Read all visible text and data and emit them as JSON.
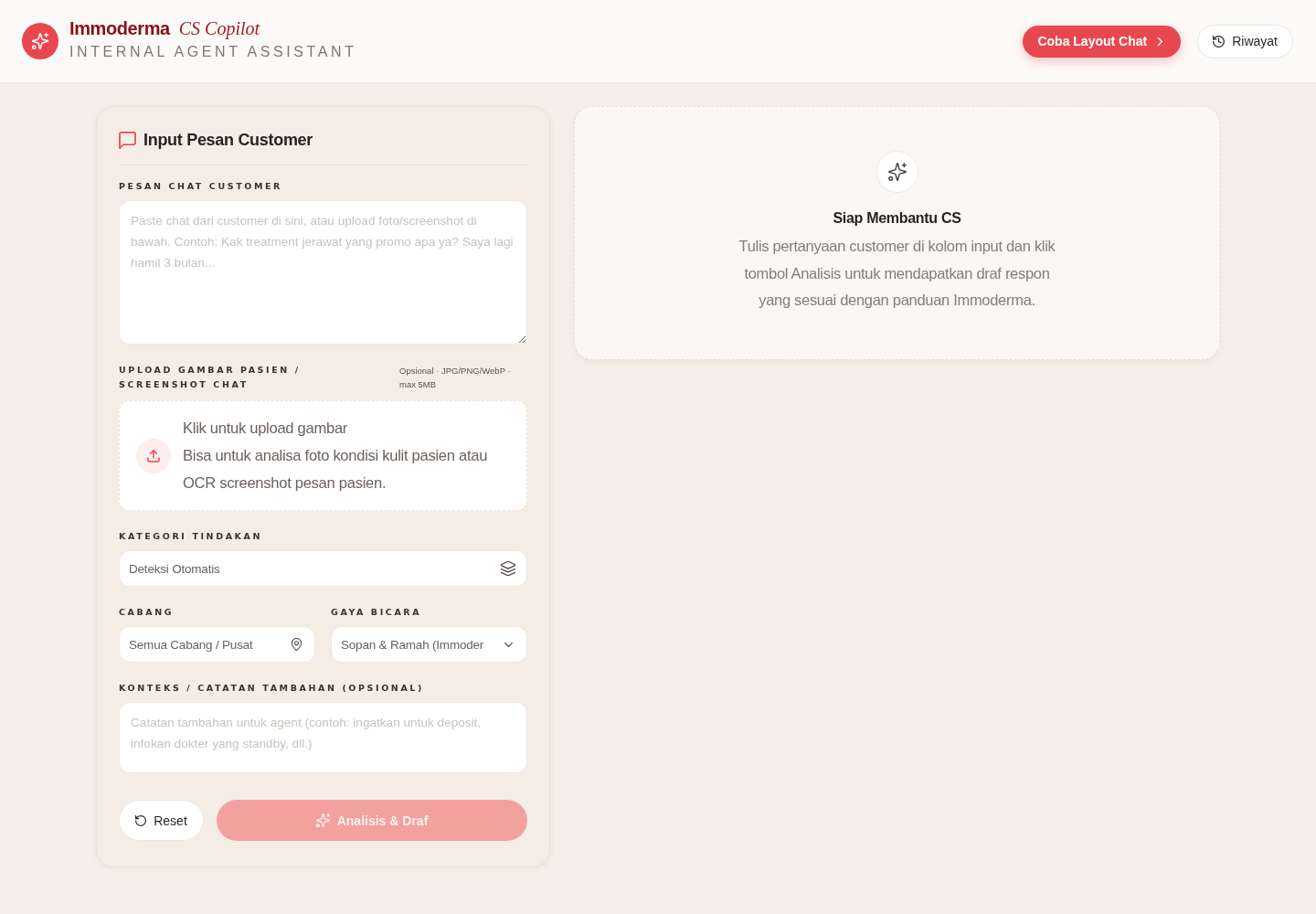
{
  "header": {
    "brand": "Immoderma",
    "product": "CS Copilot",
    "tagline": "INTERNAL AGENT ASSISTANT",
    "buttons": [
      {
        "label": "Coba Layout Chat",
        "kind": "primary"
      },
      {
        "label": "Riwayat",
        "kind": "history"
      }
    ]
  },
  "input_panel": {
    "title": "Input Pesan Customer",
    "message": {
      "label": "PESAN CHAT CUSTOMER",
      "placeholder": "Paste chat dari customer di sini, atau upload foto/screenshot di bawah. Contoh: Kak treatment jerawat yang promo apa ya? Saya lagi hamil 3 bulan..."
    },
    "upload": {
      "label": "UPLOAD GAMBAR PASIEN / SCREENSHOT CHAT",
      "hint": "Opsional · JPG/PNG/WebP · max 5MB",
      "title": "Klik untuk upload gambar",
      "description": "Bisa untuk analisa foto kondisi kulit pasien atau OCR screenshot pesan pasien."
    },
    "category": {
      "label": "KATEGORI TINDAKAN",
      "value": "Deteksi Otomatis"
    },
    "branch": {
      "label": "CABANG",
      "value": "Semua Cabang / Pusat"
    },
    "tone": {
      "label": "GAYA BICARA",
      "value": "Sopan & Ramah (Immoder"
    },
    "notes": {
      "label": "KONTEKS / CATATAN TAMBAHAN (OPSIONAL)",
      "placeholder": "Catatan tambahan untuk agent (contoh: ingatkan untuk deposit, infokan dokter yang standby, dll.)"
    },
    "actions": [
      {
        "label": "Reset",
        "kind": "reset",
        "disabled": false
      },
      {
        "label": "Analisis & Draf",
        "kind": "analyze",
        "disabled": true
      }
    ]
  },
  "result_panel": {
    "title": "Siap Membantu CS",
    "description": "Tulis pertanyaan customer di kolom input dan klik tombol Analisis untuk mendapatkan draf respon yang sesuai dengan panduan Immoderma."
  }
}
